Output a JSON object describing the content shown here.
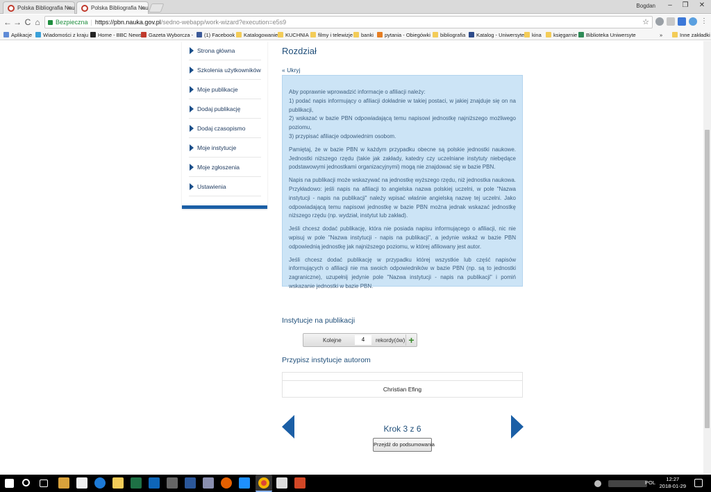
{
  "browser": {
    "tabs": [
      {
        "title": "Polska Bibliografia Nauk",
        "close": "×"
      },
      {
        "title": "Polska Bibliografia Nauk",
        "close": "×"
      }
    ],
    "user": "Bogdan",
    "window_controls": {
      "minimize": "–",
      "maximize": "❐",
      "close": "✕"
    },
    "nav": {
      "back": "←",
      "forward": "→",
      "reload": "C",
      "home": "⌂"
    },
    "address": {
      "secure_label": "Bezpieczna",
      "separator": "|",
      "host": "https://pbn.nauka.gov.pl",
      "path": "/sedno-webapp/work-wizard?execution=e5s9",
      "star": "☆"
    },
    "bookmarks": [
      {
        "label": "Aplikacje",
        "color": "#5f8bd6"
      },
      {
        "label": "Wiadomości z kraju",
        "color": "#3aa0d8"
      },
      {
        "label": "Home - BBC News",
        "color": "#222222"
      },
      {
        "label": "Gazeta Wyborcza - ",
        "color": "#c0392b"
      },
      {
        "label": "(1) Facebook",
        "color": "#3b5998"
      },
      {
        "label": "Katalogowanie",
        "color": "#f3cc58"
      },
      {
        "label": "KUCHNIA",
        "color": "#f3cc58"
      },
      {
        "label": "filmy i telewizje",
        "color": "#f3cc58"
      },
      {
        "label": "banki",
        "color": "#f3cc58"
      },
      {
        "label": "pytania - Obiegówki",
        "color": "#e67e22"
      },
      {
        "label": "bibliografia",
        "color": "#f3cc58"
      },
      {
        "label": "Katalog - Uniwersyte",
        "color": "#2c4a8a"
      },
      {
        "label": "kina",
        "color": "#f3cc58"
      },
      {
        "label": "księgarnie",
        "color": "#f3cc58"
      },
      {
        "label": "Biblioteka Uniwersyte",
        "color": "#2e8b57"
      },
      {
        "label": "»",
        "color": ""
      },
      {
        "label": "Inne zakładki",
        "color": "#f3cc58"
      }
    ]
  },
  "sidebar": {
    "items": [
      {
        "label": "Strona główna"
      },
      {
        "label": "Szkolenia użytkowników"
      },
      {
        "label": "Moje publikacje"
      },
      {
        "label": "Dodaj publikację"
      },
      {
        "label": "Dodaj czasopismo"
      },
      {
        "label": "Moje instytucje"
      },
      {
        "label": "Moje zgłoszenia"
      },
      {
        "label": "Ustawienia"
      }
    ]
  },
  "main": {
    "heading": "Rozdział",
    "hide_link": "« Ukryj",
    "info": {
      "p1": "Aby poprawnie wprowadzić informacje o afiliacji należy:",
      "p1_l1": "1) podać napis informujący o afiliacji dokładnie w takiej postaci, w jakiej znajduje się on na publikacji,",
      "p1_l2": "2) wskazać w bazie PBN odpowiadającą temu napisowi jednostkę najniższego możliwego poziomu,",
      "p1_l3": "3) przypisać afiliacje odpowiednim osobom.",
      "p2": "Pamiętaj, że w bazie PBN w każdym przypadku obecne są polskie jednostki naukowe. Jednostki niższego rzędu (takie jak zakłady, katedry czy uczelniane instytuty niebędące podstawowymi jednostkami organizacyjnymi) mogą nie znajdować się w bazie PBN.",
      "p3": "Napis na publikacji może wskazywać na jednostkę wyższego rzędu, niż jednostka naukowa. Przykładowo: jeśli napis na afiliacji to angielska nazwa polskiej uczelni, w pole \"Nazwa instytucji - napis na publikacji\" należy wpisać właśnie angielską nazwę tej uczelni. Jako odpowiadającą temu napisowi jednostkę w bazie PBN można jednak wskazać jednostkę niższego rzędu (np. wydział, instytut lub zakład).",
      "p4": "Jeśli chcesz dodać publikację, która nie posiada napisu informującego o afiliacji, nic nie wpisuj w pole \"Nazwa instytucji - napis na publikacji\", a jedynie wskaż w bazie PBN odpowiednią jednostkę jak najniższego poziomu, w której afiliowany jest autor.",
      "p5": "Jeśli chcesz dodać publikację w przypadku której wszystkie lub część napisów informujących o afiliacji nie ma swoich odpowiedników w bazie PBN (np. są to jednostki zagraniczne), uzupełnij jedynie pole \"Nazwa instytucji - napis na publikacji\" i pomiń wskazanie jednostki w bazie PBN."
    },
    "institutions_title": "Instytucje na publikacji",
    "counter": {
      "label": "Kolejne",
      "value": "4",
      "unit": "rekordy(ów)",
      "add": "+"
    },
    "assign_title": "Przypisz instytucje autorom",
    "authors": [
      "Christian Efing"
    ],
    "step": "Krok 3 z 6",
    "summary_button": "Przejdź do podsumowania"
  },
  "taskbar": {
    "lang": "POL",
    "time": "12:27",
    "date": "2018-01-29"
  }
}
